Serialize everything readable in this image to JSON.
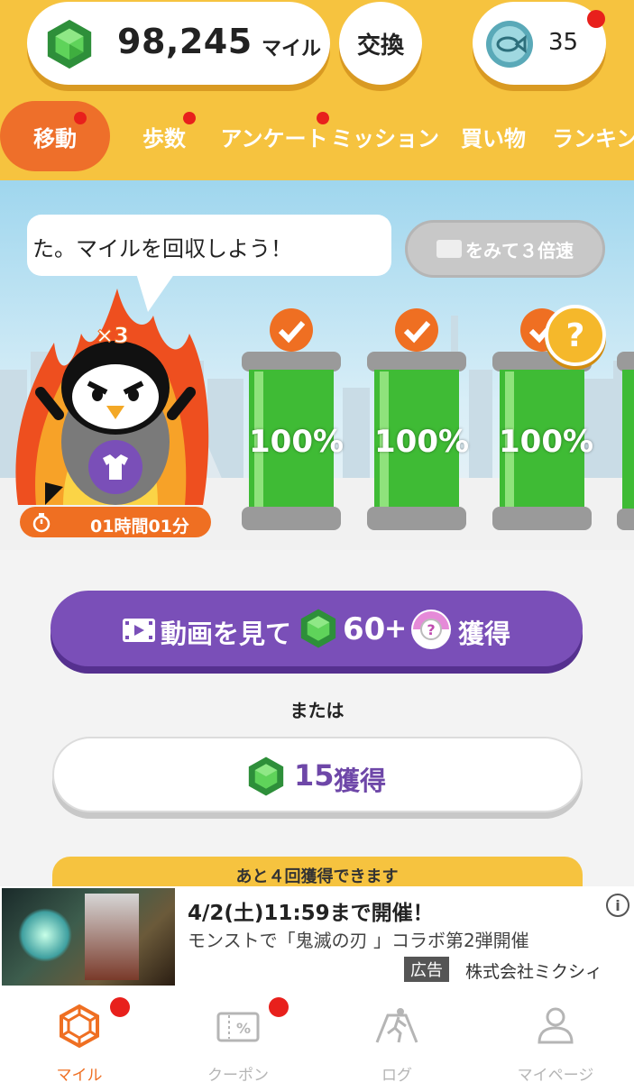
{
  "header": {
    "miles_value": "98,245",
    "miles_unit": "マイル",
    "exchange_label": "交換",
    "coin_count": "35"
  },
  "tabs": [
    {
      "label": "移動",
      "active": true,
      "badge": true
    },
    {
      "label": "歩数",
      "active": false,
      "badge": true
    },
    {
      "label": "アンケート",
      "active": false,
      "badge": true
    },
    {
      "label": "ミッション",
      "active": false,
      "badge": false
    },
    {
      "label": "買い物",
      "active": false,
      "badge": false
    },
    {
      "label": "ランキン",
      "active": false,
      "badge": false
    }
  ],
  "scene": {
    "speech": "た。マイルを回収しよう！",
    "triple_label": "をみて３倍速",
    "multiplier": "×3",
    "timer": "01時間01分",
    "tanks": [
      {
        "percent": "100%",
        "checked": true
      },
      {
        "percent": "100%",
        "checked": true
      },
      {
        "percent": "100%",
        "checked": true
      }
    ],
    "mystery": "?"
  },
  "actions": {
    "watch_label": "動画を見て",
    "watch_amount": "60",
    "watch_plus": "+",
    "watch_get": "獲得",
    "or_label": "または",
    "get_amount": "15",
    "get_label": "獲得",
    "remaining": "あと４回獲得できます"
  },
  "ad": {
    "title": "4/2(土)11:59まで開催！",
    "description": "モンストで「鬼滅の刃 」コラボ第2弾開催",
    "badge": "広告",
    "company": "株式会社ミクシィ"
  },
  "nav": [
    {
      "label": "マイル",
      "active": true,
      "badge": true
    },
    {
      "label": "クーポン",
      "active": false,
      "badge": true
    },
    {
      "label": "ログ",
      "active": false,
      "badge": false
    },
    {
      "label": "マイページ",
      "active": false,
      "badge": false
    }
  ],
  "colors": {
    "header_bg": "#f6c33f",
    "accent_orange": "#ef6f22",
    "purple": "#7a4fb8",
    "gem_green": "#3cb44a",
    "badge_red": "#e8201c"
  }
}
